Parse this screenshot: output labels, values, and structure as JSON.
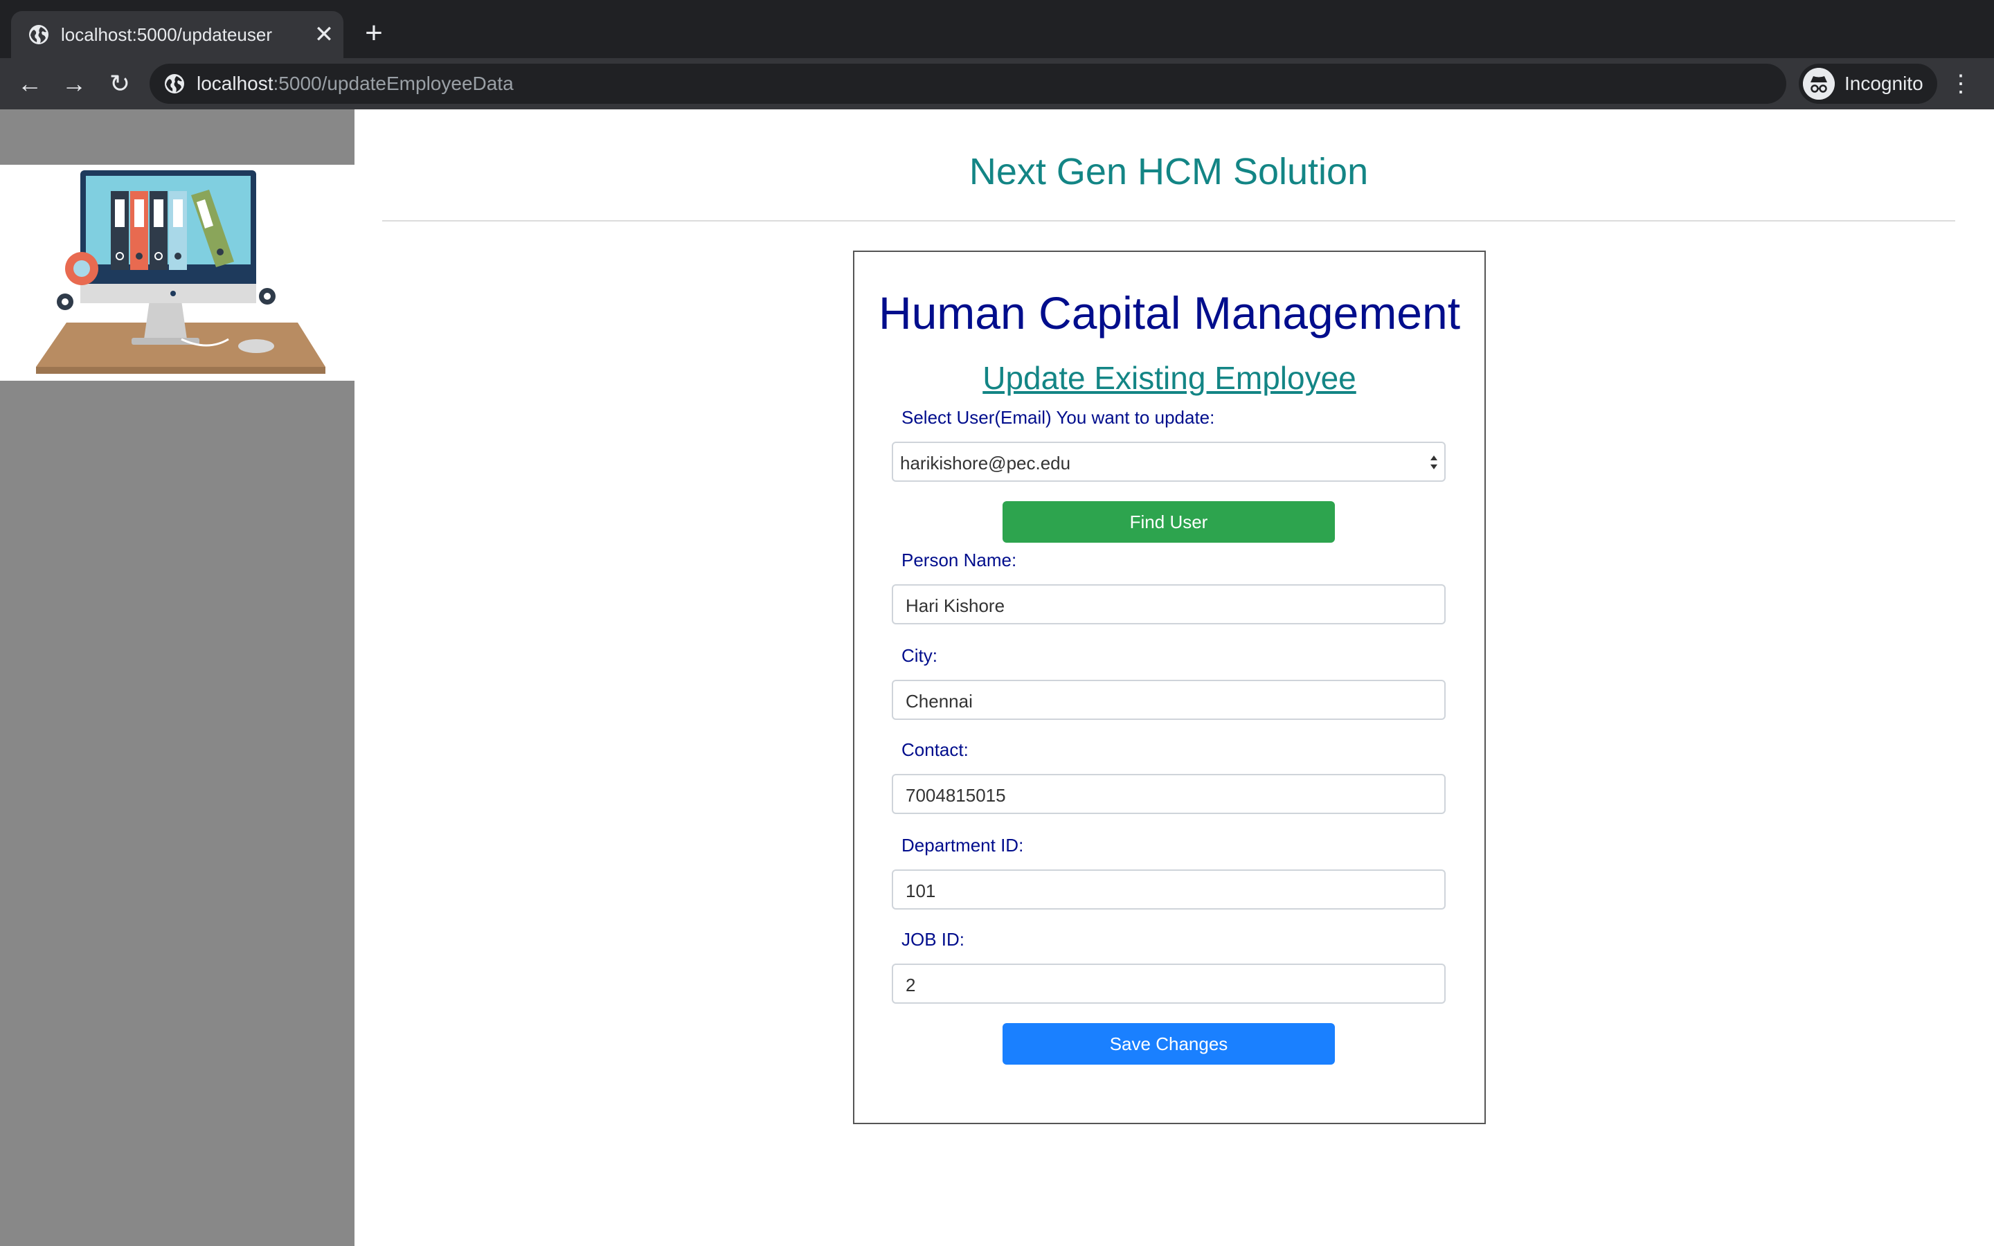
{
  "browser": {
    "tab_title": "localhost:5000/updateuser",
    "url_host": "localhost",
    "url_rest": ":5000/updateEmployeeData",
    "incognito_label": "Incognito"
  },
  "page": {
    "site_title": "Next Gen HCM Solution"
  },
  "form": {
    "heading": "Human Capital Management",
    "subheading": "Update Existing Employee",
    "select_label": "Select User(Email) You want to update:",
    "selected_email": "harikishore@pec.edu",
    "find_button": "Find User",
    "fields": [
      {
        "label": "Person Name:",
        "value": "Hari Kishore"
      },
      {
        "label": "City:",
        "value": "Chennai"
      },
      {
        "label": "Contact:",
        "value": "7004815015"
      },
      {
        "label": "Department ID:",
        "value": "101"
      },
      {
        "label": "JOB ID:",
        "value": "2"
      }
    ],
    "save_button": "Save Changes"
  },
  "colors": {
    "site_title": "#138585",
    "heading": "#000d8c",
    "find_button": "#2da44e",
    "save_button": "#1a80ff",
    "sidebar": "#888888"
  }
}
